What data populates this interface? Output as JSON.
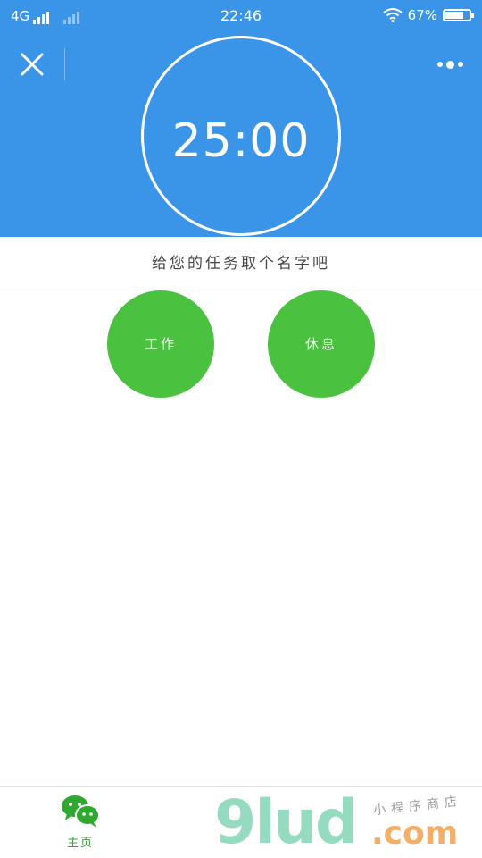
{
  "status_bar": {
    "network": "4G",
    "time": "22:46",
    "battery": "67%"
  },
  "nav": {
    "close_icon": "close-icon",
    "more_icon": "more-dots-icon"
  },
  "timer": {
    "display": "25:00"
  },
  "task": {
    "placeholder": "给您的任务取个名字吧"
  },
  "modes": {
    "work_label": "工作",
    "rest_label": "休息"
  },
  "tab_bar": {
    "home_label": "主页",
    "home_icon": "wechat-chat-icon"
  },
  "watermark": {
    "logo": "9lud",
    "suffix": ".com",
    "sub": "小程序商店"
  },
  "colors": {
    "header_blue": "#3a95e9",
    "accent_green": "#4ac13f",
    "tab_green": "#2fa82f"
  }
}
